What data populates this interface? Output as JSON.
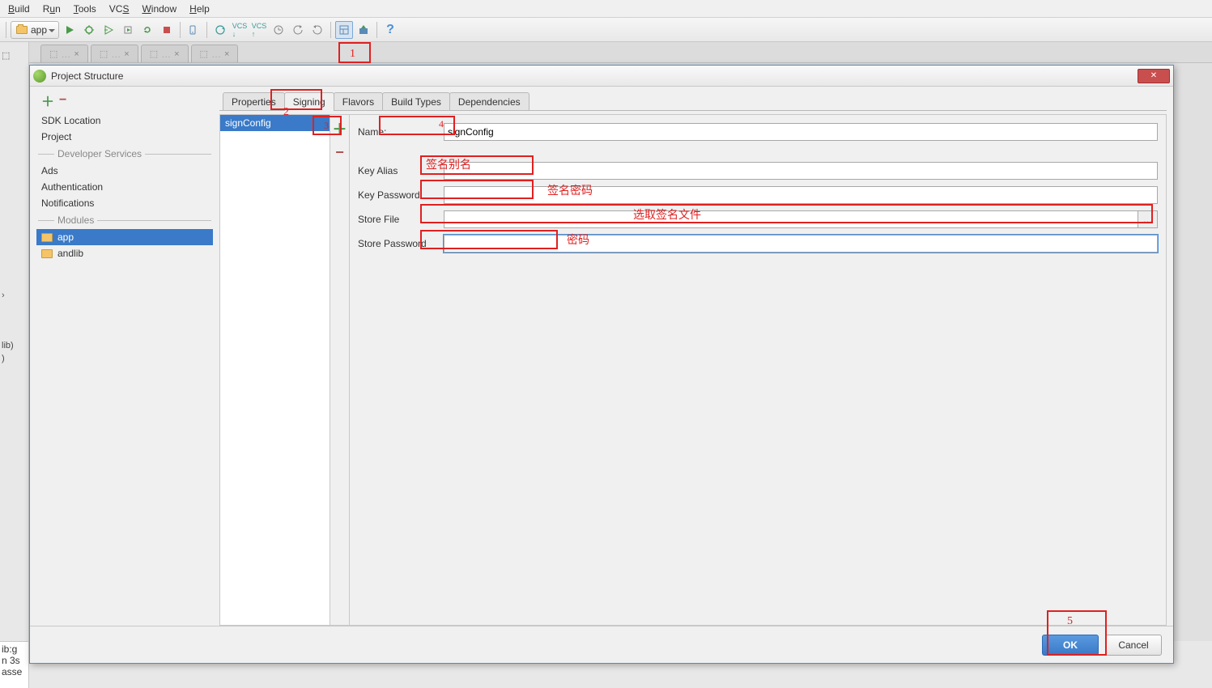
{
  "menubar": [
    "Build",
    "Run",
    "Tools",
    "VCS",
    "Window",
    "Help"
  ],
  "toolbar": {
    "app_label": "app"
  },
  "bg_tabs": [
    "…",
    "…",
    "…",
    "…"
  ],
  "left_fragment": {
    "lib": "lib)"
  },
  "console_lines": [
    "ib:g",
    "n 3s",
    "asse"
  ],
  "dialog": {
    "title": "Project Structure",
    "nav": {
      "items_top": [
        "SDK Location",
        "Project"
      ],
      "dev_services_label": "Developer Services",
      "items_dev": [
        "Ads",
        "Authentication",
        "Notifications"
      ],
      "modules_label": "Modules",
      "modules": [
        "app",
        "andlib"
      ],
      "selected_module": "app"
    },
    "tabs": [
      "Properties",
      "Signing",
      "Flavors",
      "Build Types",
      "Dependencies"
    ],
    "active_tab": "Signing",
    "config_list": [
      "signConfig"
    ],
    "form": {
      "name_label": "Name:",
      "name_value": "signConfig",
      "key_alias_label": "Key Alias",
      "key_alias_value": "",
      "key_password_label": "Key Password",
      "key_password_value": "",
      "store_file_label": "Store File",
      "store_file_value": "",
      "store_password_label": "Store Password",
      "store_password_value": ""
    },
    "buttons": {
      "ok": "OK",
      "cancel": "Cancel"
    }
  },
  "annotations": {
    "n1": "1",
    "n2": "2",
    "n3": "3",
    "n4": "4",
    "n5": "5",
    "key_alias_hint": "签名别名",
    "key_password_hint": "签名密码",
    "store_file_hint": "选取签名文件",
    "store_password_hint": "密码"
  }
}
